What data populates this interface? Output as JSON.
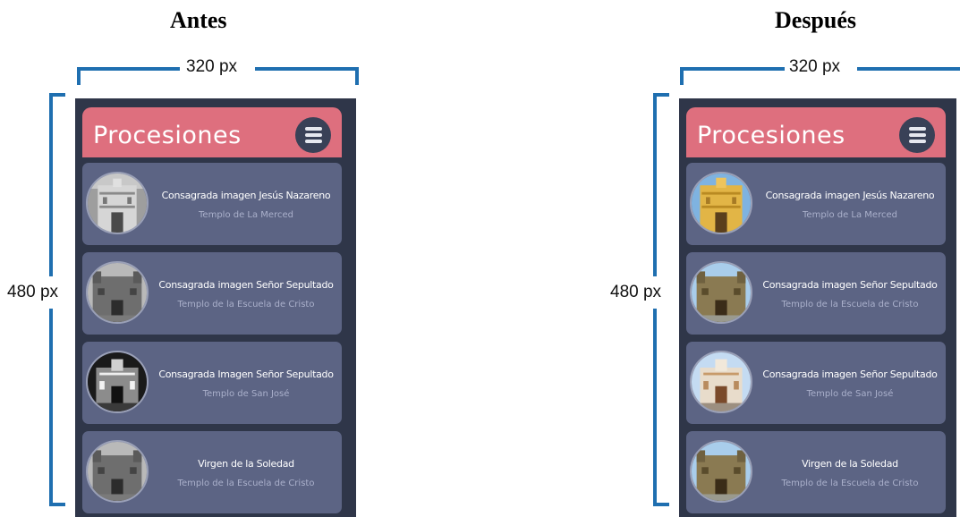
{
  "panels": [
    {
      "heading": "Antes",
      "width_label": "320 px",
      "height_label": "480 px",
      "variant": "grayscale",
      "app": {
        "title": "Procesiones",
        "items": [
          {
            "title": "Consagrada imagen Jesús Nazareno",
            "subtitle": "Templo de La Merced",
            "image": "church-la-merced"
          },
          {
            "title": "Consagrada imagen Señor Sepultado",
            "subtitle": "Templo de la Escuela de Cristo",
            "image": "church-escuela-de-cristo"
          },
          {
            "title": "Consagrada Imagen Señor Sepultado",
            "subtitle": "Templo de  San José",
            "image": "church-san-jose-night"
          },
          {
            "title": "Virgen de la Soledad",
            "subtitle": "Templo de la Escuela de Cristo",
            "image": "church-escuela-de-cristo"
          }
        ]
      }
    },
    {
      "heading": "Después",
      "width_label": "320 px",
      "height_label": "480 px",
      "variant": "color",
      "app": {
        "title": "Procesiones",
        "items": [
          {
            "title": "Consagrada imagen Jesús Nazareno",
            "subtitle": "Templo de La Merced",
            "image": "church-la-merced"
          },
          {
            "title": "Consagrada imagen Señor Sepultado",
            "subtitle": "Templo de la Escuela de Cristo",
            "image": "church-escuela-de-cristo"
          },
          {
            "title": "Consagrada imagen Señor Sepultado",
            "subtitle": "Templo de  San José",
            "image": "church-san-jose"
          },
          {
            "title": "Virgen de la Soledad",
            "subtitle": "Templo de la Escuela de Cristo",
            "image": "church-escuela-de-cristo"
          }
        ]
      }
    }
  ],
  "colors": {
    "header": "#de6f7e",
    "phone_bg": "#2f3649",
    "card_bg": "#5c6484",
    "menu_button": "#394157",
    "dimension_line": "#1f6fb0"
  },
  "icons": {
    "menu": "hamburger-menu-icon"
  }
}
